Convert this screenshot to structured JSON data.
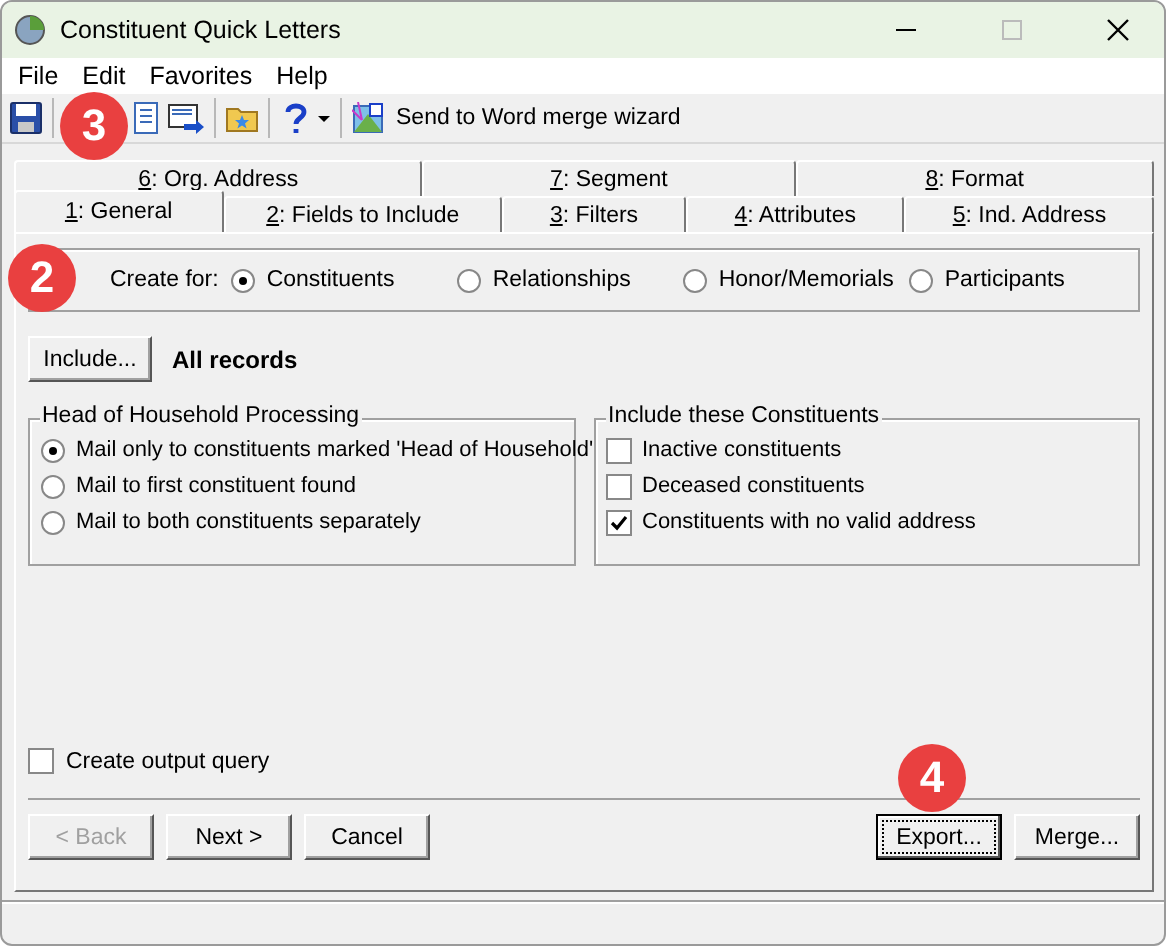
{
  "window": {
    "title": "Constituent Quick Letters"
  },
  "menu": [
    "File",
    "Edit",
    "Favorites",
    "Help"
  ],
  "toolbar": {
    "wizard_label": "Send to Word merge wizard"
  },
  "tabs_back": [
    {
      "label": "6: Org. Address",
      "selected": false
    },
    {
      "label": "7: Segment",
      "selected": false
    },
    {
      "label": "8: Format",
      "selected": false
    }
  ],
  "tabs_front": [
    {
      "label": "1: General",
      "selected": true
    },
    {
      "label": "2: Fields to Include",
      "selected": false
    },
    {
      "label": "3: Filters",
      "selected": false
    },
    {
      "label": "4: Attributes",
      "selected": false
    },
    {
      "label": "5: Ind. Address",
      "selected": false
    }
  ],
  "create_for": {
    "label": "Create for:",
    "options": [
      {
        "label": "Constituents",
        "selected": true
      },
      {
        "label": "Relationships",
        "selected": false
      },
      {
        "label": "Honor/Memorials",
        "selected": false
      },
      {
        "label": "Participants",
        "selected": false
      }
    ]
  },
  "include": {
    "button": "Include...",
    "value": "All records"
  },
  "head_of_household": {
    "title": "Head of Household Processing",
    "options": [
      {
        "label": "Mail only to constituents marked 'Head of Household'",
        "selected": true
      },
      {
        "label": "Mail to first constituent found",
        "selected": false
      },
      {
        "label": "Mail to both constituents separately",
        "selected": false
      }
    ]
  },
  "include_constituents": {
    "title": "Include these Constituents",
    "items": [
      {
        "label": "Inactive constituents",
        "checked": false
      },
      {
        "label": "Deceased constituents",
        "checked": false
      },
      {
        "label": "Constituents with no valid address",
        "checked": true
      }
    ]
  },
  "create_output_query": {
    "label": "Create output query",
    "checked": false
  },
  "buttons_left": [
    {
      "label": "< Back",
      "disabled": true,
      "focused": false
    },
    {
      "label": "Next >",
      "disabled": false,
      "focused": false
    },
    {
      "label": "Cancel",
      "disabled": false,
      "focused": false
    }
  ],
  "buttons_right": [
    {
      "label": "Export...",
      "disabled": false,
      "focused": true
    },
    {
      "label": "Merge...",
      "disabled": false,
      "focused": false
    }
  ],
  "badges": [
    "3",
    "2",
    "4"
  ]
}
